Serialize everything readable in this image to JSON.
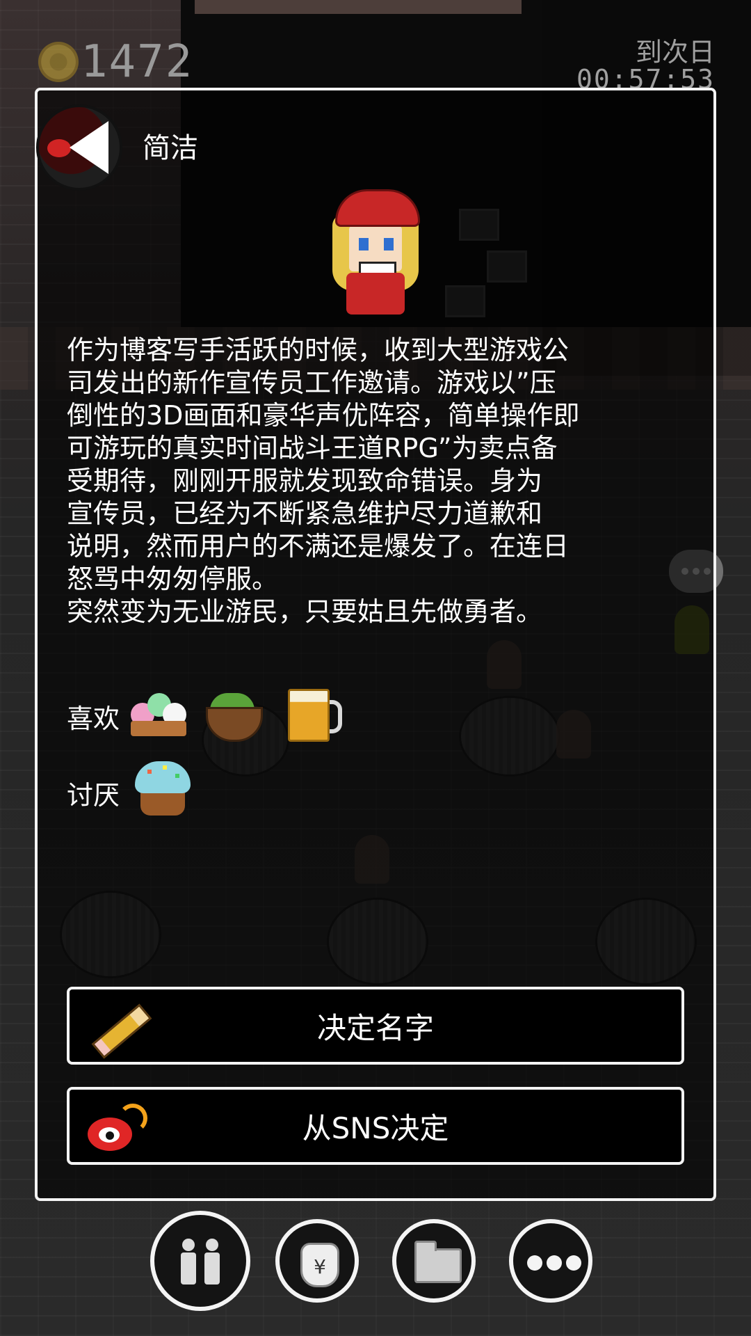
{
  "hud": {
    "coins": "1472",
    "next_day_label": "到次日",
    "next_day_timer": "00:57:53"
  },
  "profile": {
    "name": "简洁",
    "bio": "作为博客写手活跃的时候，收到大型游戏公\n司发出的新作宣传员工作邀请。游戏以”压\n倒性的3D画面和豪华声优阵容，简单操作即\n可游玩的真实时间战斗王道RPG”为卖点备\n受期待，刚刚开服就发现致命错误。身为\n宣传员，已经为不断紧急维护尽力道歉和\n说明，然而用户的不满还是爆发了。在连日\n怒骂中匆匆停服。\n突然变为无业游民，只要姑且先做勇者。",
    "likes_label": "喜欢",
    "likes": [
      "mochi-dango-icon",
      "bowl-dish-icon",
      "beer-mug-icon"
    ],
    "dislikes_label": "讨厌",
    "dislikes": [
      "frosted-cake-icon"
    ]
  },
  "actions": {
    "decide_name": "决定名字",
    "decide_sns": "从SNS决定"
  },
  "nav": {
    "items": [
      "party-icon",
      "money-bag-icon",
      "folder-icon",
      "more-icon"
    ]
  },
  "colors": {
    "panel_border": "#f4f4f4",
    "panel_bg": "rgba(0,0,0,0.62)",
    "weibo_red": "#e02626",
    "coin_gold": "#d6b33a"
  }
}
